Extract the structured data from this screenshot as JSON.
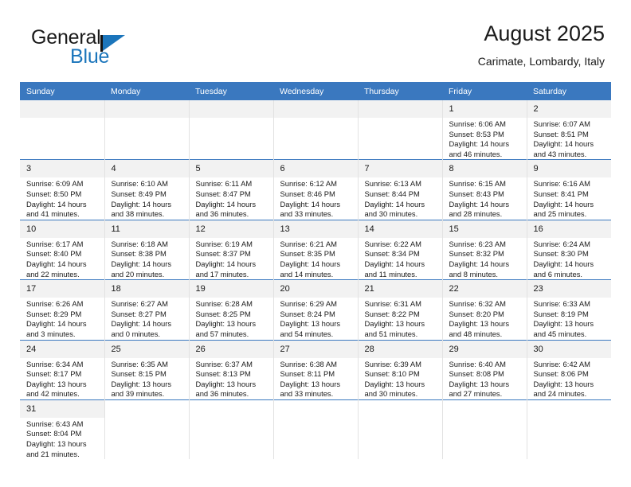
{
  "brand": {
    "name_part1": "General",
    "name_part2": "Blue",
    "flag_icon": "flag-triangle-icon",
    "accent_color": "#1b75bb"
  },
  "header": {
    "title": "August 2025",
    "subtitle": "Carimate, Lombardy, Italy"
  },
  "calendar": {
    "header_bg": "#3a78bf",
    "daynum_bg": "#f2f2f2",
    "weekdays": [
      "Sunday",
      "Monday",
      "Tuesday",
      "Wednesday",
      "Thursday",
      "Friday",
      "Saturday"
    ],
    "weeks": [
      [
        {
          "day": "",
          "empty": true
        },
        {
          "day": "",
          "empty": true
        },
        {
          "day": "",
          "empty": true
        },
        {
          "day": "",
          "empty": true
        },
        {
          "day": "",
          "empty": true
        },
        {
          "day": "1",
          "sunrise": "Sunrise: 6:06 AM",
          "sunset": "Sunset: 8:53 PM",
          "daylight1": "Daylight: 14 hours",
          "daylight2": "and 46 minutes."
        },
        {
          "day": "2",
          "sunrise": "Sunrise: 6:07 AM",
          "sunset": "Sunset: 8:51 PM",
          "daylight1": "Daylight: 14 hours",
          "daylight2": "and 43 minutes."
        }
      ],
      [
        {
          "day": "3",
          "sunrise": "Sunrise: 6:09 AM",
          "sunset": "Sunset: 8:50 PM",
          "daylight1": "Daylight: 14 hours",
          "daylight2": "and 41 minutes."
        },
        {
          "day": "4",
          "sunrise": "Sunrise: 6:10 AM",
          "sunset": "Sunset: 8:49 PM",
          "daylight1": "Daylight: 14 hours",
          "daylight2": "and 38 minutes."
        },
        {
          "day": "5",
          "sunrise": "Sunrise: 6:11 AM",
          "sunset": "Sunset: 8:47 PM",
          "daylight1": "Daylight: 14 hours",
          "daylight2": "and 36 minutes."
        },
        {
          "day": "6",
          "sunrise": "Sunrise: 6:12 AM",
          "sunset": "Sunset: 8:46 PM",
          "daylight1": "Daylight: 14 hours",
          "daylight2": "and 33 minutes."
        },
        {
          "day": "7",
          "sunrise": "Sunrise: 6:13 AM",
          "sunset": "Sunset: 8:44 PM",
          "daylight1": "Daylight: 14 hours",
          "daylight2": "and 30 minutes."
        },
        {
          "day": "8",
          "sunrise": "Sunrise: 6:15 AM",
          "sunset": "Sunset: 8:43 PM",
          "daylight1": "Daylight: 14 hours",
          "daylight2": "and 28 minutes."
        },
        {
          "day": "9",
          "sunrise": "Sunrise: 6:16 AM",
          "sunset": "Sunset: 8:41 PM",
          "daylight1": "Daylight: 14 hours",
          "daylight2": "and 25 minutes."
        }
      ],
      [
        {
          "day": "10",
          "sunrise": "Sunrise: 6:17 AM",
          "sunset": "Sunset: 8:40 PM",
          "daylight1": "Daylight: 14 hours",
          "daylight2": "and 22 minutes."
        },
        {
          "day": "11",
          "sunrise": "Sunrise: 6:18 AM",
          "sunset": "Sunset: 8:38 PM",
          "daylight1": "Daylight: 14 hours",
          "daylight2": "and 20 minutes."
        },
        {
          "day": "12",
          "sunrise": "Sunrise: 6:19 AM",
          "sunset": "Sunset: 8:37 PM",
          "daylight1": "Daylight: 14 hours",
          "daylight2": "and 17 minutes."
        },
        {
          "day": "13",
          "sunrise": "Sunrise: 6:21 AM",
          "sunset": "Sunset: 8:35 PM",
          "daylight1": "Daylight: 14 hours",
          "daylight2": "and 14 minutes."
        },
        {
          "day": "14",
          "sunrise": "Sunrise: 6:22 AM",
          "sunset": "Sunset: 8:34 PM",
          "daylight1": "Daylight: 14 hours",
          "daylight2": "and 11 minutes."
        },
        {
          "day": "15",
          "sunrise": "Sunrise: 6:23 AM",
          "sunset": "Sunset: 8:32 PM",
          "daylight1": "Daylight: 14 hours",
          "daylight2": "and 8 minutes."
        },
        {
          "day": "16",
          "sunrise": "Sunrise: 6:24 AM",
          "sunset": "Sunset: 8:30 PM",
          "daylight1": "Daylight: 14 hours",
          "daylight2": "and 6 minutes."
        }
      ],
      [
        {
          "day": "17",
          "sunrise": "Sunrise: 6:26 AM",
          "sunset": "Sunset: 8:29 PM",
          "daylight1": "Daylight: 14 hours",
          "daylight2": "and 3 minutes."
        },
        {
          "day": "18",
          "sunrise": "Sunrise: 6:27 AM",
          "sunset": "Sunset: 8:27 PM",
          "daylight1": "Daylight: 14 hours",
          "daylight2": "and 0 minutes."
        },
        {
          "day": "19",
          "sunrise": "Sunrise: 6:28 AM",
          "sunset": "Sunset: 8:25 PM",
          "daylight1": "Daylight: 13 hours",
          "daylight2": "and 57 minutes."
        },
        {
          "day": "20",
          "sunrise": "Sunrise: 6:29 AM",
          "sunset": "Sunset: 8:24 PM",
          "daylight1": "Daylight: 13 hours",
          "daylight2": "and 54 minutes."
        },
        {
          "day": "21",
          "sunrise": "Sunrise: 6:31 AM",
          "sunset": "Sunset: 8:22 PM",
          "daylight1": "Daylight: 13 hours",
          "daylight2": "and 51 minutes."
        },
        {
          "day": "22",
          "sunrise": "Sunrise: 6:32 AM",
          "sunset": "Sunset: 8:20 PM",
          "daylight1": "Daylight: 13 hours",
          "daylight2": "and 48 minutes."
        },
        {
          "day": "23",
          "sunrise": "Sunrise: 6:33 AM",
          "sunset": "Sunset: 8:19 PM",
          "daylight1": "Daylight: 13 hours",
          "daylight2": "and 45 minutes."
        }
      ],
      [
        {
          "day": "24",
          "sunrise": "Sunrise: 6:34 AM",
          "sunset": "Sunset: 8:17 PM",
          "daylight1": "Daylight: 13 hours",
          "daylight2": "and 42 minutes."
        },
        {
          "day": "25",
          "sunrise": "Sunrise: 6:35 AM",
          "sunset": "Sunset: 8:15 PM",
          "daylight1": "Daylight: 13 hours",
          "daylight2": "and 39 minutes."
        },
        {
          "day": "26",
          "sunrise": "Sunrise: 6:37 AM",
          "sunset": "Sunset: 8:13 PM",
          "daylight1": "Daylight: 13 hours",
          "daylight2": "and 36 minutes."
        },
        {
          "day": "27",
          "sunrise": "Sunrise: 6:38 AM",
          "sunset": "Sunset: 8:11 PM",
          "daylight1": "Daylight: 13 hours",
          "daylight2": "and 33 minutes."
        },
        {
          "day": "28",
          "sunrise": "Sunrise: 6:39 AM",
          "sunset": "Sunset: 8:10 PM",
          "daylight1": "Daylight: 13 hours",
          "daylight2": "and 30 minutes."
        },
        {
          "day": "29",
          "sunrise": "Sunrise: 6:40 AM",
          "sunset": "Sunset: 8:08 PM",
          "daylight1": "Daylight: 13 hours",
          "daylight2": "and 27 minutes."
        },
        {
          "day": "30",
          "sunrise": "Sunrise: 6:42 AM",
          "sunset": "Sunset: 8:06 PM",
          "daylight1": "Daylight: 13 hours",
          "daylight2": "and 24 minutes."
        }
      ],
      [
        {
          "day": "31",
          "sunrise": "Sunrise: 6:43 AM",
          "sunset": "Sunset: 8:04 PM",
          "daylight1": "Daylight: 13 hours",
          "daylight2": "and 21 minutes."
        },
        {
          "day": "",
          "empty": true,
          "nofill": true
        },
        {
          "day": "",
          "empty": true,
          "nofill": true
        },
        {
          "day": "",
          "empty": true,
          "nofill": true
        },
        {
          "day": "",
          "empty": true,
          "nofill": true
        },
        {
          "day": "",
          "empty": true,
          "nofill": true
        },
        {
          "day": "",
          "empty": true,
          "nofill": true
        }
      ]
    ]
  }
}
